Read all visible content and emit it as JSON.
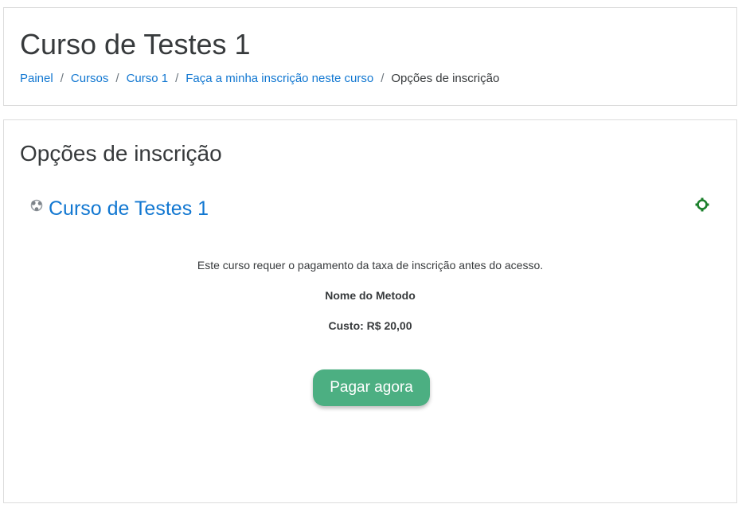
{
  "header": {
    "title": "Curso de Testes 1",
    "breadcrumb": [
      {
        "label": "Painel",
        "link": true
      },
      {
        "label": "Cursos",
        "link": true
      },
      {
        "label": "Curso 1",
        "link": true
      },
      {
        "label": "Faça a minha inscrição neste curso",
        "link": true
      },
      {
        "label": "Opções de inscrição",
        "link": false
      }
    ],
    "separator": "/"
  },
  "main": {
    "section_title": "Opções de inscrição",
    "course": {
      "icon": "course-icon",
      "name": "Curso de Testes 1",
      "enrol_icon": "enrol-plugin-icon"
    },
    "fee_text": "Este curso requer o pagamento da taxa de inscrição antes do acesso.",
    "method_name": "Nome do Metodo",
    "cost_line": "Custo: R$ 20,00",
    "pay_button_label": "Pagar agora"
  },
  "colors": {
    "link": "#1177d1",
    "pay_button": "#4caf82",
    "enrol_icon": "#1a7f2a"
  }
}
